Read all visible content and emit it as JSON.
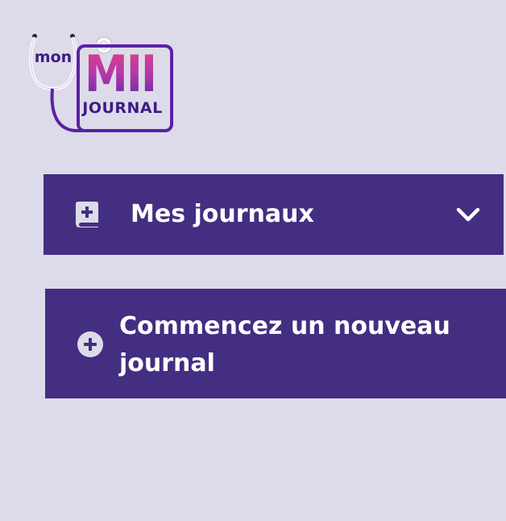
{
  "page": {
    "background": "#dddbe9"
  },
  "logo": {
    "prefix": "mon",
    "title": "MII",
    "subtitle": "JOURNAL",
    "icon": "stethoscope-icon"
  },
  "menu": {
    "accent": "#432e82",
    "items": [
      {
        "label": "Mes journaux",
        "icon": "book-plus-icon",
        "trailing_icon": "chevron-down-icon"
      },
      {
        "label": "Commencez un nouveau journal",
        "icon": "plus-circle-icon"
      }
    ]
  }
}
